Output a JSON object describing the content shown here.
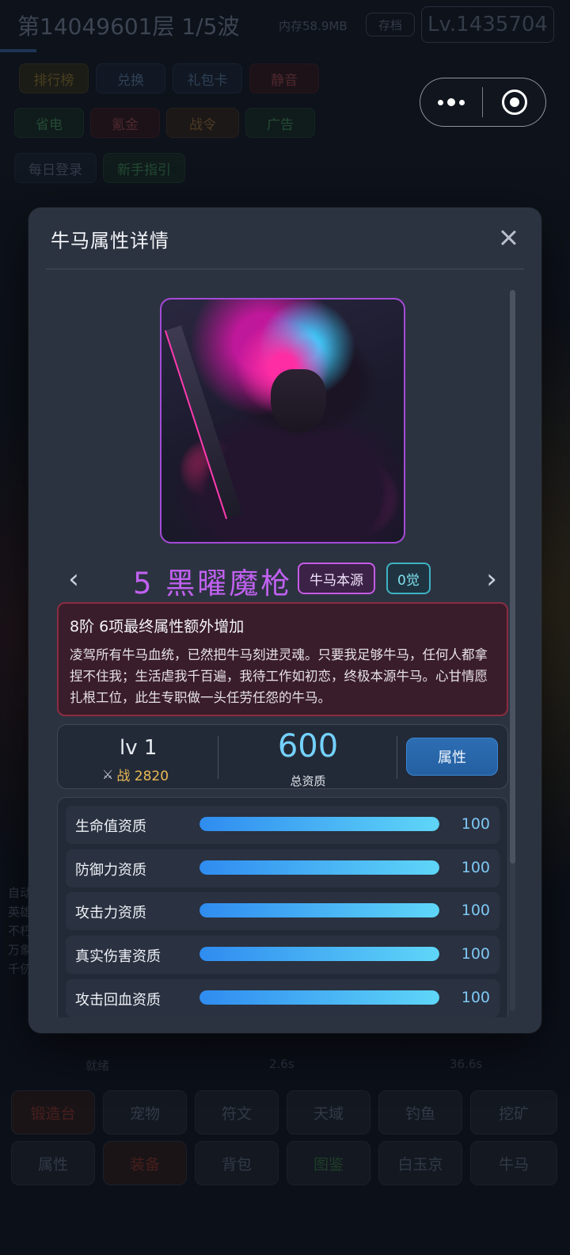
{
  "background": {
    "top_title": "第14049601层  1/5波",
    "memory": "内存58.9MB",
    "save_label": "存档",
    "level": "Lv.1435704",
    "buttons_row1": [
      "排行榜",
      "兑换",
      "礼包卡",
      "静音"
    ],
    "buttons_row2": [
      "省电",
      "氪金",
      "战令",
      "广告"
    ],
    "buttons_row3": [
      "每日登录",
      "新手指引"
    ],
    "side_texts": [
      "自动",
      "英雄",
      "不朽",
      "万象",
      "千仞"
    ],
    "timers": [
      "就绪",
      "2.6s",
      "36.6s"
    ],
    "bottom_row1": [
      "锻造台",
      "宠物",
      "符文",
      "天域",
      "钓鱼",
      "挖矿"
    ],
    "bottom_row2": [
      "属性",
      "装备",
      "背包",
      "图鉴",
      "白玉京",
      "牛马"
    ]
  },
  "capsule": {
    "more_icon": "more-dots-icon",
    "close_icon": "target-close-icon"
  },
  "modal": {
    "title": "牛马属性详情",
    "close_icon": "close-icon",
    "hero": {
      "name": "5  黑曜魔枪",
      "tag_origin": "牛马本源",
      "tag_awaken": "0觉",
      "desc_title": "8阶  6项最终属性额外增加",
      "desc_body": "凌驾所有牛马血统，已然把牛马刻进灵魂。只要我足够牛马，任何人都拿捏不住我；生活虐我千百遍，我待工作如初恋，终极本源牛马。心甘情愿扎根工位，此生专职做一头任劳任怨的牛马。"
    },
    "stats": {
      "level": "lv 1",
      "power_icon": "crossed-swords-icon",
      "power": "战 2820",
      "total": "600",
      "total_label": "总资质",
      "attr_button": "属性"
    },
    "aptitudes": [
      {
        "label": "生命值资质",
        "value": "100",
        "fill": 1.0
      },
      {
        "label": "防御力资质",
        "value": "100",
        "fill": 1.0
      },
      {
        "label": "攻击力资质",
        "value": "100",
        "fill": 1.0
      },
      {
        "label": "真实伤害资质",
        "value": "100",
        "fill": 1.0
      },
      {
        "label": "攻击回血资质",
        "value": "100",
        "fill": 1.0
      }
    ]
  },
  "colors": {
    "accent_purple": "#c061f0",
    "accent_blue": "#74d2ff",
    "power_gold": "#e9b955",
    "desc_bg": "#3a1d2a"
  }
}
